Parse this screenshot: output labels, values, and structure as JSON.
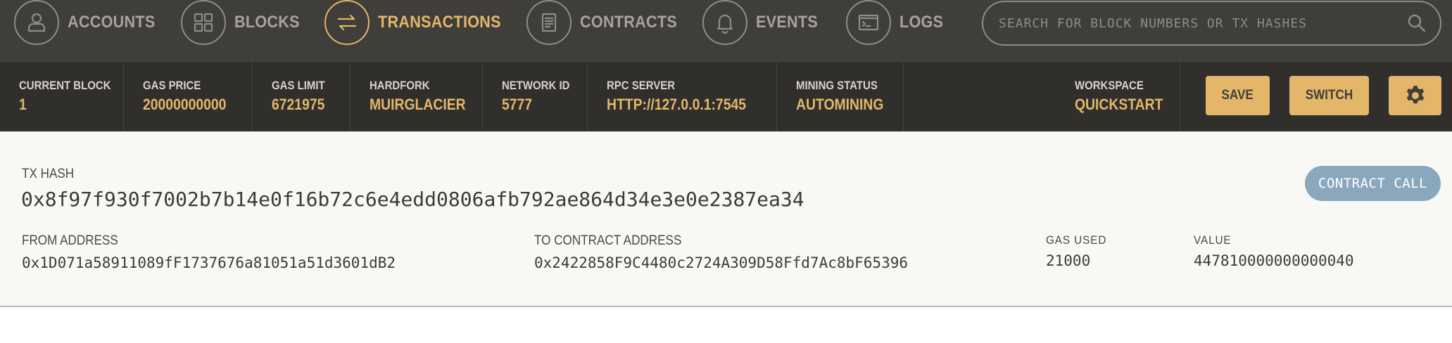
{
  "nav": {
    "items": [
      {
        "label": "ACCOUNTS",
        "icon": "person-icon"
      },
      {
        "label": "BLOCKS",
        "icon": "grid-icon"
      },
      {
        "label": "TRANSACTIONS",
        "icon": "swap-arrows-icon",
        "active": true
      },
      {
        "label": "CONTRACTS",
        "icon": "document-icon"
      },
      {
        "label": "EVENTS",
        "icon": "bell-icon"
      },
      {
        "label": "LOGS",
        "icon": "terminal-icon"
      }
    ],
    "search_placeholder": "SEARCH FOR BLOCK NUMBERS OR TX HASHES"
  },
  "status": {
    "current_block": {
      "label": "CURRENT BLOCK",
      "value": "1"
    },
    "gas_price": {
      "label": "GAS PRICE",
      "value": "20000000000"
    },
    "gas_limit": {
      "label": "GAS LIMIT",
      "value": "6721975"
    },
    "hardfork": {
      "label": "HARDFORK",
      "value": "MUIRGLACIER"
    },
    "network_id": {
      "label": "NETWORK ID",
      "value": "5777"
    },
    "rpc_server": {
      "label": "RPC SERVER",
      "value": "HTTP://127.0.0.1:7545"
    },
    "mining_status": {
      "label": "MINING STATUS",
      "value": "AUTOMINING"
    },
    "workspace": {
      "label": "WORKSPACE",
      "value": "QUICKSTART"
    },
    "save_label": "SAVE",
    "switch_label": "SWITCH"
  },
  "tx": {
    "hash_label": "TX HASH",
    "hash": "0x8f97f930f7002b7b14e0f16b72c6e4edd0806afb792ae864d34e3e0e2387ea34",
    "type_badge": "CONTRACT CALL",
    "from_label": "FROM ADDRESS",
    "from": "0x1D071a58911089fF1737676a81051a51d3601dB2",
    "to_label": "TO CONTRACT ADDRESS",
    "to": "0x2422858F9C4480c2724A309D58Ffd7Ac8bF65396",
    "gas_used_label": "GAS USED",
    "gas_used": "21000",
    "value_label": "VALUE",
    "value": "447810000000000040"
  },
  "colors": {
    "nav_bg": "#3f3e3a",
    "status_bg": "#302f2c",
    "accent": "#e4b66a",
    "badge_bg": "#8aa8bd",
    "card_bg": "#f9f8f5"
  }
}
